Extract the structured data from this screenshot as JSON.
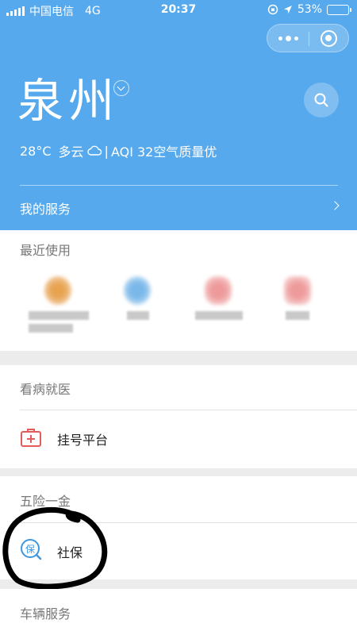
{
  "status_bar": {
    "carrier": "中国电信",
    "network": "4G",
    "time": "20:37",
    "battery": "53%",
    "battery_level": 0.53
  },
  "header": {
    "city": "泉州",
    "weather": {
      "temp": "28°C",
      "condition": "多云",
      "aqi": "AQI 32空气质量优"
    },
    "my_services": "我的服务"
  },
  "recent": {
    "title": "最近使用"
  },
  "medical": {
    "title": "看病就医",
    "items": [
      {
        "label": "挂号平台",
        "icon": "hospital-kit-icon"
      }
    ]
  },
  "insurance": {
    "title": "五险一金",
    "items": [
      {
        "label": "社保",
        "icon": "social-insurance-icon",
        "icon_glyph": "保"
      }
    ]
  },
  "vehicle": {
    "title": "车辆服务"
  },
  "colors": {
    "header_bg": "#56a9ec",
    "accent_red": "#e25c5c",
    "accent_blue": "#3a97e0"
  }
}
